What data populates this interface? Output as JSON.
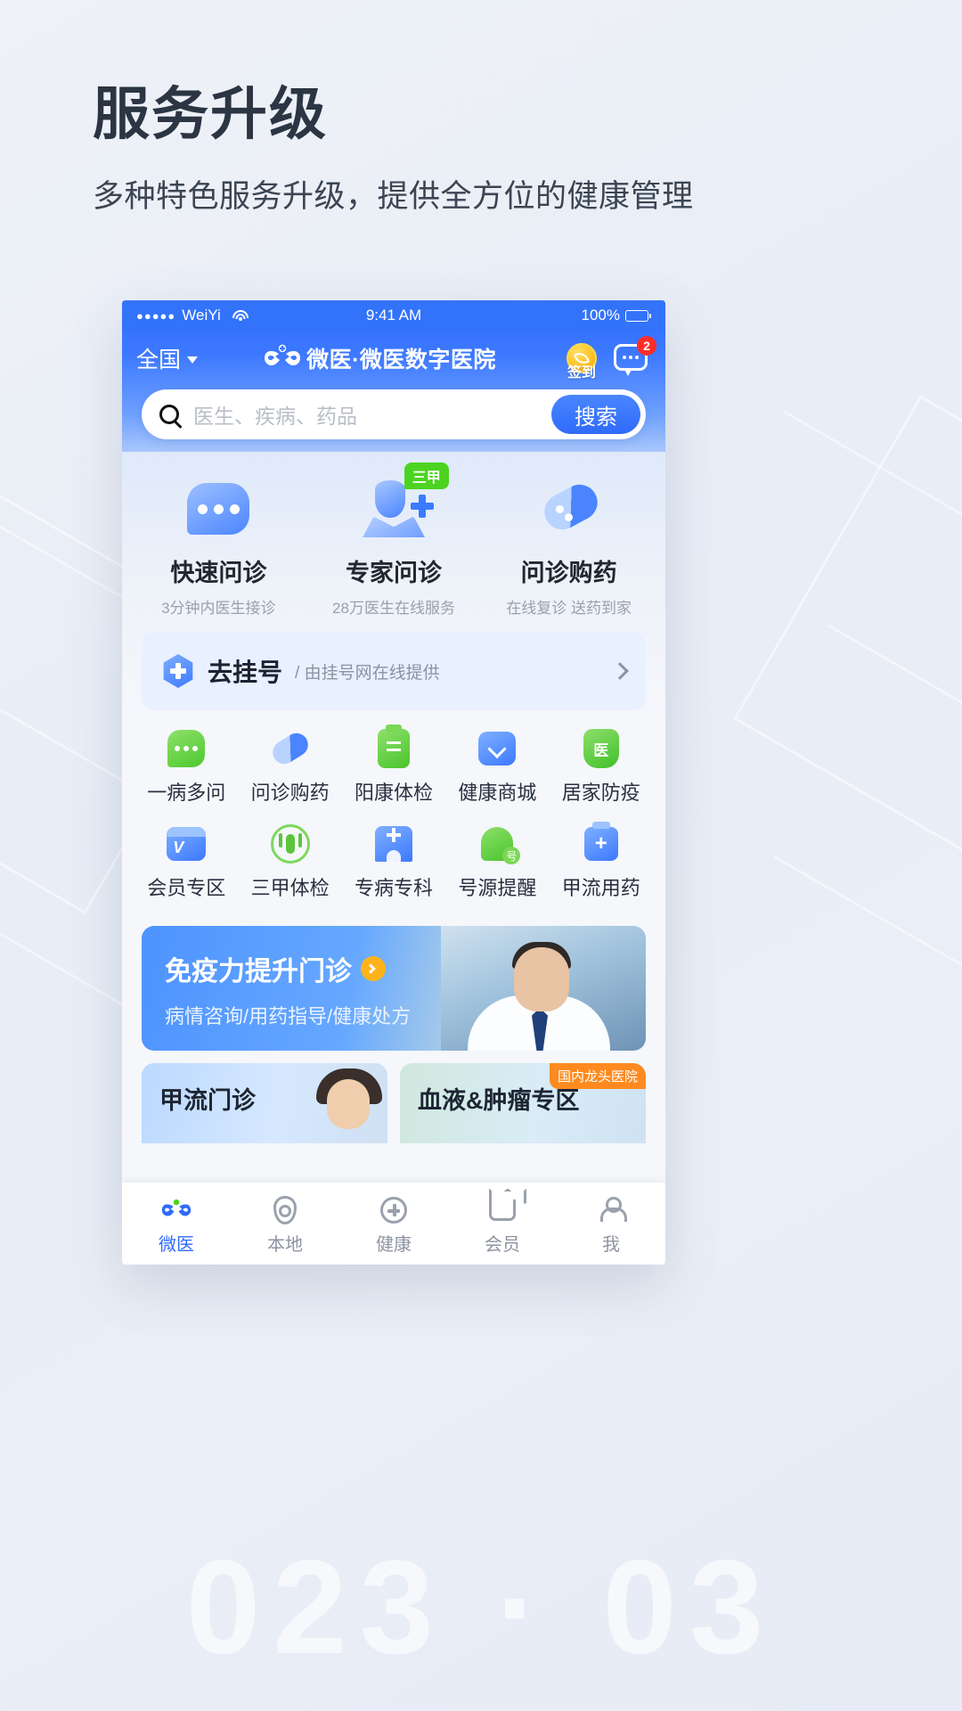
{
  "promo": {
    "title": "服务升级",
    "subtitle": "多种特色服务升级，提供全方位的健康管理",
    "watermark": "023 · 03"
  },
  "status_bar": {
    "signal_dots": "●●●●●",
    "carrier": "WeiYi",
    "wifi_icon": "wifi-icon",
    "time": "9:41 AM",
    "battery_text": "100%"
  },
  "navbar": {
    "region": "全国",
    "region_caret": "chevron-down-icon",
    "brand_logo": "wedoctor-logo-icon",
    "brand_sub": "wedoctor",
    "brand_name": "微医·微医数字医院",
    "signin_label": "签到",
    "signin_icon": "coin-icon",
    "chat_icon": "chat-bubble-icon",
    "chat_badge": "2"
  },
  "search": {
    "icon": "search-icon",
    "placeholder": "医生、疾病、药品",
    "value": "",
    "button_label": "搜索"
  },
  "entries": [
    {
      "icon": "chat-bubble-illustration",
      "title": "快速问诊",
      "sub": "3分钟内医生接诊",
      "tag": ""
    },
    {
      "icon": "doctor-illustration",
      "title": "专家问诊",
      "sub": "28万医生在线服务",
      "tag": "三甲"
    },
    {
      "icon": "pill-illustration",
      "title": "问诊购药",
      "sub": "在线复诊 送药到家",
      "tag": ""
    }
  ],
  "register_card": {
    "icon": "hospital-cross-icon",
    "title": "去挂号",
    "sub": "/ 由挂号网在线提供",
    "chevron": "chevron-right-icon"
  },
  "grid": [
    {
      "icon": "chat-green-icon",
      "label": "一病多问"
    },
    {
      "icon": "pill-blue-icon",
      "label": "问诊购药"
    },
    {
      "icon": "clipboard-icon",
      "label": "阳康体检"
    },
    {
      "icon": "shopping-bag-icon",
      "label": "健康商城"
    },
    {
      "icon": "shield-med-icon",
      "label": "居家防疫"
    },
    {
      "icon": "vip-card-icon",
      "label": "会员专区"
    },
    {
      "icon": "body-check-icon",
      "label": "三甲体检"
    },
    {
      "icon": "hospital-icon",
      "label": "专病专科"
    },
    {
      "icon": "bell-icon",
      "label": "号源提醒"
    },
    {
      "icon": "medicine-bottle-icon",
      "label": "甲流用药"
    }
  ],
  "banner": {
    "title": "免疫力提升门诊",
    "arrow_icon": "arrow-right-circle-icon",
    "sub": "病情咨询/用药指导/健康处方",
    "photo": "doctor-photo"
  },
  "mini_banners": [
    {
      "title": "甲流门诊",
      "tag": "",
      "photo": "patient-photo"
    },
    {
      "title": "血液&肿瘤专区",
      "tag": "国内龙头医院",
      "photo": ""
    }
  ],
  "tabbar": [
    {
      "icon": "wedoctor-logo-icon",
      "label": "微医",
      "active": true
    },
    {
      "icon": "location-pin-icon",
      "label": "本地",
      "active": false
    },
    {
      "icon": "health-plus-icon",
      "label": "健康",
      "active": false
    },
    {
      "icon": "crown-icon",
      "label": "会员",
      "active": false
    },
    {
      "icon": "user-icon",
      "label": "我",
      "active": false
    }
  ],
  "colors": {
    "brand_blue": "#2f6bfa",
    "accent_green": "#4cd320",
    "badge_red": "#ff2d28",
    "tag_orange": "#ff8a1f",
    "coin_gold": "#ffc022"
  }
}
